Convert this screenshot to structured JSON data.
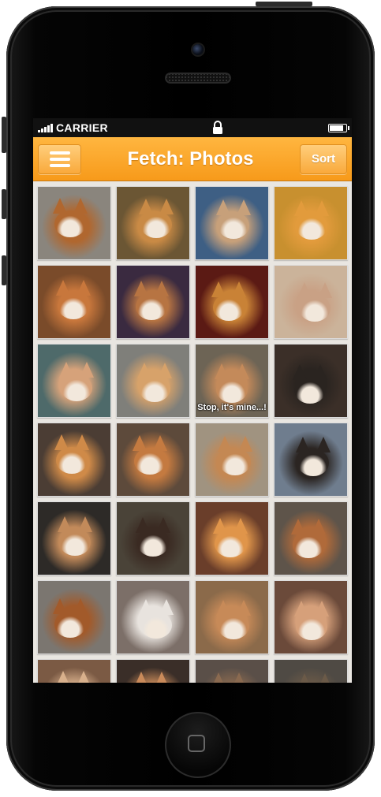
{
  "status": {
    "carrier": "CARRIER",
    "battery_level": 0.9
  },
  "navbar": {
    "title": "Fetch: Photos",
    "menu_icon": "hamburger-menu-icon",
    "sort_label": "Sort"
  },
  "colors": {
    "accent": "#f9a22a",
    "status_bar": "#111111",
    "screen_bg": "#e9e6e1"
  },
  "photos": [
    {
      "desc": "corgi and puppy on couch",
      "bg": "#8a857d",
      "fur": "#b0672f"
    },
    {
      "desc": "corgi in autumn leaves",
      "bg": "#6b5634",
      "fur": "#c98a45"
    },
    {
      "desc": "dog lying on blue couch",
      "bg": "#3e5f84",
      "fur": "#c7a07a"
    },
    {
      "desc": "corgi puppy close-up",
      "bg": "#c8902f",
      "fur": "#e29b3c"
    },
    {
      "desc": "corgi face close-up",
      "bg": "#7a4b2a",
      "fur": "#c8773c"
    },
    {
      "desc": "corgi on purple floor",
      "bg": "#3a2a40",
      "fur": "#b77442"
    },
    {
      "desc": "corgi with red hat",
      "bg": "#5b1a14",
      "fur": "#c98236"
    },
    {
      "desc": "fluffy corgi puppy",
      "bg": "#cbb39a",
      "fur": "#c9a185"
    },
    {
      "desc": "corgi with person",
      "bg": "#4e6a6a",
      "fur": "#d6a27a"
    },
    {
      "desc": "corgi standing",
      "bg": "#7f7f7a",
      "fur": "#d7a26a"
    },
    {
      "desc": "corgi stop it's mine",
      "bg": "#6d6455",
      "fur": "#c48a5a",
      "caption": "Stop, it's mine...!"
    },
    {
      "desc": "dog with killer shirt",
      "bg": "#3b2f28",
      "fur": "#2a2420"
    },
    {
      "desc": "corgi portrait",
      "bg": "#4b3d34",
      "fur": "#cf8a48"
    },
    {
      "desc": "corgi in yellow sweater",
      "bg": "#5d4a3b",
      "fur": "#c47a40"
    },
    {
      "desc": "fluffy corgi sitting",
      "bg": "#a09380",
      "fur": "#c48853"
    },
    {
      "desc": "dog on floor",
      "bg": "#6f7d8e",
      "fur": "#2b2522"
    },
    {
      "desc": "corgi in hoodie",
      "bg": "#2d2a27",
      "fur": "#c28a5a"
    },
    {
      "desc": "tricolor corgi",
      "bg": "#4a4338",
      "fur": "#3a2a22"
    },
    {
      "desc": "puppy sleeping on pillow",
      "bg": "#6a3e2a",
      "fur": "#e0954a"
    },
    {
      "desc": "puppies on rug",
      "bg": "#5e544a",
      "fur": "#b06a3a"
    },
    {
      "desc": "corgi puppies litter",
      "bg": "#7b7670",
      "fur": "#a25a2a"
    },
    {
      "desc": "corgi close-up white",
      "bg": "#7c6f68",
      "fur": "#e8e3de"
    },
    {
      "desc": "corgi on floor",
      "bg": "#8b6a4a",
      "fur": "#c78a58"
    },
    {
      "desc": "corgi in dog bed",
      "bg": "#6b4a3a",
      "fur": "#d6a07a"
    },
    {
      "desc": "person partial",
      "bg": "#7b5a44",
      "fur": "#d8b08c"
    },
    {
      "desc": "corgi partial",
      "bg": "#3a2e28",
      "fur": "#c98a5a"
    },
    {
      "desc": "room partial",
      "bg": "#5a4f48",
      "fur": "#8a6a50"
    },
    {
      "desc": "room partial 2",
      "bg": "#4f4a44",
      "fur": "#6b5a48"
    }
  ]
}
